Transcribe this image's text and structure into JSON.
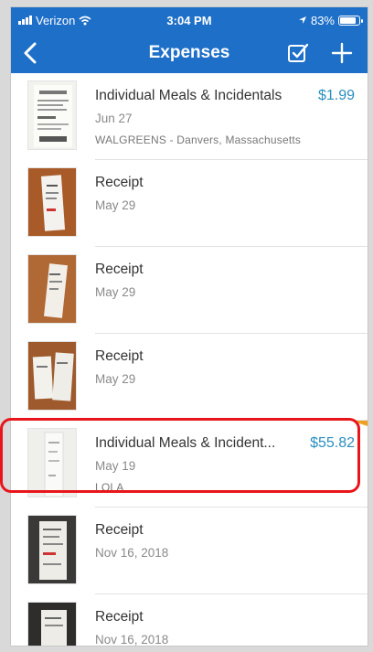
{
  "status": {
    "carrier": "Verizon",
    "time": "3:04 PM",
    "battery": "83%",
    "battery_level": 0.83
  },
  "nav": {
    "title": "Expenses"
  },
  "items": [
    {
      "title": "Individual Meals & Incidentals",
      "date": "Jun 27",
      "detail": "WALGREENS - Danvers, Massachusetts",
      "amount": "$1.99"
    },
    {
      "title": "Receipt",
      "date": "May 29",
      "detail": "",
      "amount": ""
    },
    {
      "title": "Receipt",
      "date": "May 29",
      "detail": "",
      "amount": ""
    },
    {
      "title": "Receipt",
      "date": "May 29",
      "detail": "",
      "amount": ""
    },
    {
      "title": "Individual Meals & Incident...",
      "date": "May 19",
      "detail": "LOLA",
      "amount": "$55.82"
    },
    {
      "title": "Receipt",
      "date": "Nov 16, 2018",
      "detail": "",
      "amount": ""
    },
    {
      "title": "Receipt",
      "date": "Nov 16, 2018",
      "detail": "",
      "amount": ""
    }
  ],
  "colors": {
    "brand": "#1e6fc8",
    "amount": "#2a8fc0",
    "highlight": "#e8151b"
  }
}
